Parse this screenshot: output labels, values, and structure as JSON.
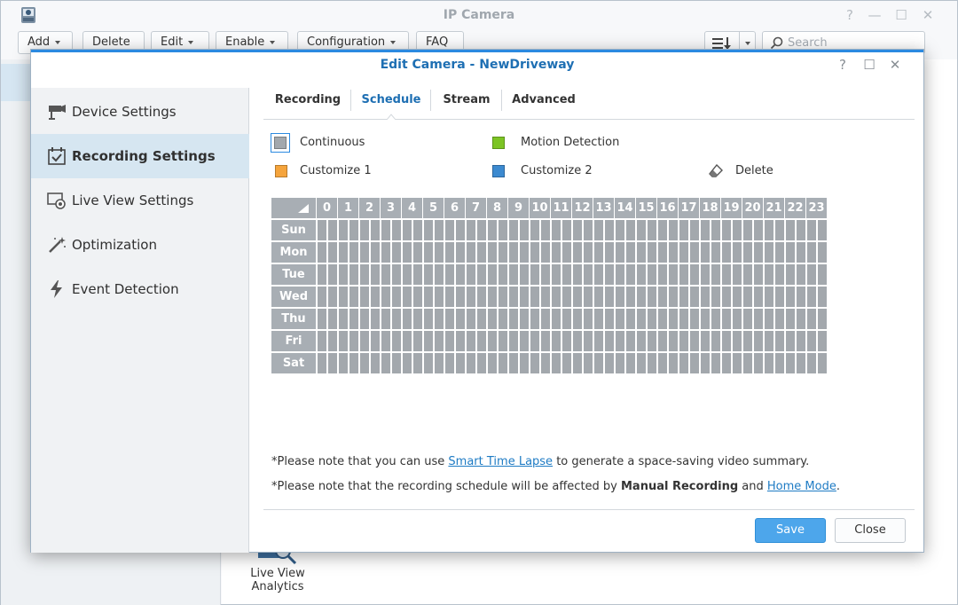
{
  "app": {
    "title": "IP Camera",
    "toolbar": {
      "add": "Add",
      "delete": "Delete",
      "edit": "Edit",
      "enable": "Enable",
      "configuration": "Configuration",
      "faq": "FAQ"
    },
    "search_placeholder": "Search",
    "background_item": {
      "label_line1": "Live View",
      "label_line2": "Analytics"
    }
  },
  "dialog": {
    "title": "Edit Camera - NewDriveway",
    "sidebar": [
      {
        "label": "Device Settings",
        "icon": "camera-icon",
        "selected": false
      },
      {
        "label": "Recording Settings",
        "icon": "calendar-check-icon",
        "selected": true
      },
      {
        "label": "Live View Settings",
        "icon": "monitor-camera-icon",
        "selected": false
      },
      {
        "label": "Optimization",
        "icon": "magic-wand-icon",
        "selected": false
      },
      {
        "label": "Event Detection",
        "icon": "lightning-icon",
        "selected": false
      }
    ],
    "tabs": [
      {
        "label": "Recording",
        "active": false
      },
      {
        "label": "Schedule",
        "active": true
      },
      {
        "label": "Stream",
        "active": false
      },
      {
        "label": "Advanced",
        "active": false
      }
    ],
    "legend": {
      "continuous": {
        "label": "Continuous",
        "color": "#a3a8ad"
      },
      "motion": {
        "label": "Motion Detection",
        "color": "#7cc424"
      },
      "customize1": {
        "label": "Customize 1",
        "color": "#f5a43c"
      },
      "customize2": {
        "label": "Customize 2",
        "color": "#3c8ad0"
      },
      "delete": {
        "label": "Delete",
        "icon": "eraser-icon"
      }
    },
    "schedule": {
      "hours": [
        "0",
        "1",
        "2",
        "3",
        "4",
        "5",
        "6",
        "7",
        "8",
        "9",
        "10",
        "11",
        "12",
        "13",
        "14",
        "15",
        "16",
        "17",
        "18",
        "19",
        "20",
        "21",
        "22",
        "23"
      ],
      "days": [
        "Sun",
        "Mon",
        "Tue",
        "Wed",
        "Thu",
        "Fri",
        "Sat"
      ],
      "fill_mode": "Continuous"
    },
    "notes": {
      "note1_prefix": "*Please note that you can use ",
      "note1_link": "Smart Time Lapse",
      "note1_suffix": " to generate a space-saving video summary.",
      "note2_prefix": "*Please note that the recording schedule will be affected by ",
      "note2_bold": "Manual Recording",
      "note2_mid": " and ",
      "note2_link": "Home Mode",
      "note2_suffix": "."
    },
    "buttons": {
      "save": "Save",
      "close": "Close"
    }
  }
}
